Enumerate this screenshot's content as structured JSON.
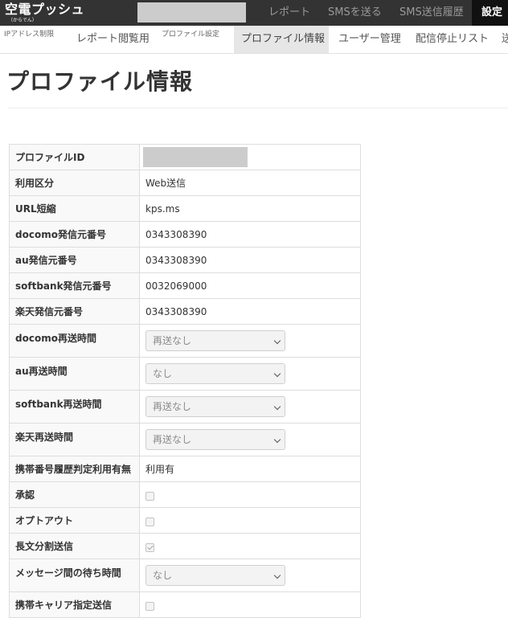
{
  "app": {
    "logo_text": "空電プッシュ",
    "logo_sub": "（からでん）"
  },
  "top_nav": {
    "items": [
      {
        "label": "レポート",
        "active": false
      },
      {
        "label": "SMSを送る",
        "active": false
      },
      {
        "label": "SMS送信履歴",
        "active": false
      },
      {
        "label": "設定",
        "active": true
      }
    ]
  },
  "sub_nav": {
    "items": [
      {
        "label": "IPアドレス制限",
        "active": false
      },
      {
        "label": "レポート閲覧用",
        "active": false
      },
      {
        "label": "プロファイル設定",
        "active": false
      },
      {
        "label": "プロファイル情報",
        "active": true
      },
      {
        "label": "ユーザー管理",
        "active": false
      },
      {
        "label": "配信停止リスト",
        "active": false
      },
      {
        "label": "送",
        "active": false
      }
    ]
  },
  "page": {
    "title": "プロファイル情報"
  },
  "profile": {
    "rows": [
      {
        "label": "プロファイルID",
        "type": "redacted"
      },
      {
        "label": "利用区分",
        "type": "text",
        "value": "Web送信"
      },
      {
        "label": "URL短縮",
        "type": "text",
        "value": "kps.ms"
      },
      {
        "label": "docomo発信元番号",
        "type": "text",
        "value": "0343308390"
      },
      {
        "label": "au発信元番号",
        "type": "text",
        "value": "0343308390"
      },
      {
        "label": "softbank発信元番号",
        "type": "text",
        "value": "0032069000"
      },
      {
        "label": "楽天発信元番号",
        "type": "text",
        "value": "0343308390"
      },
      {
        "label": "docomo再送時間",
        "type": "select",
        "value": "再送なし"
      },
      {
        "label": "au再送時間",
        "type": "select",
        "value": "なし"
      },
      {
        "label": "softbank再送時間",
        "type": "select",
        "value": "再送なし"
      },
      {
        "label": "楽天再送時間",
        "type": "select",
        "value": "再送なし"
      },
      {
        "label": "携帯番号履歴判定利用有無",
        "type": "text",
        "value": "利用有"
      },
      {
        "label": "承認",
        "type": "checkbox",
        "checked": false
      },
      {
        "label": "オプトアウト",
        "type": "checkbox",
        "checked": false
      },
      {
        "label": "長文分割送信",
        "type": "checkbox",
        "checked": true
      },
      {
        "label": "メッセージ間の待ち時間",
        "type": "select",
        "value": "なし"
      },
      {
        "label": "携帯キャリア指定送信",
        "type": "checkbox",
        "checked": false
      }
    ]
  },
  "colors": {
    "topbar": "#333333",
    "topbar_active": "#111111",
    "subnav_active": "#e6e6e6",
    "redacted": "#cccccc"
  },
  "icons": {
    "select_arrow": "chevron-down-icon",
    "checkbox_checked": "checkmark-icon"
  }
}
